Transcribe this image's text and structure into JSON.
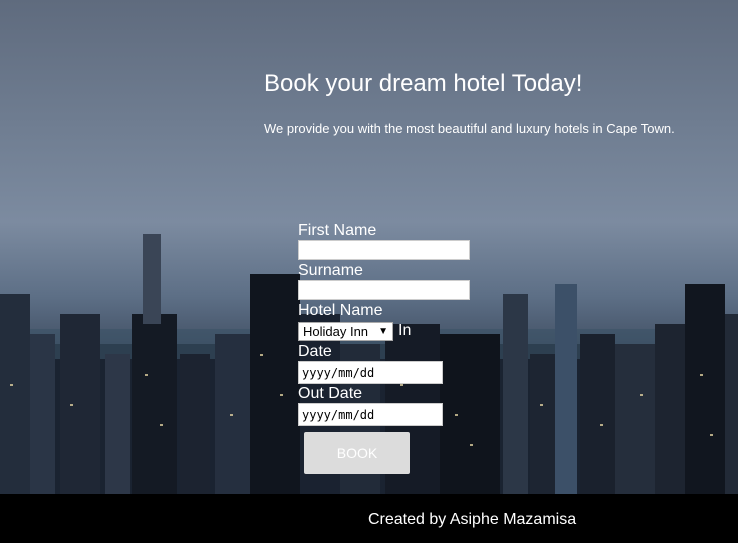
{
  "hero": {
    "title": "Book your dream hotel Today!",
    "subtitle": "We provide you with the most beautiful and luxury hotels in Cape Town."
  },
  "form": {
    "first_name_label": "First Name",
    "first_name_value": "",
    "surname_label": "Surname",
    "surname_value": "",
    "hotel_label": "Hotel Name",
    "hotel_selected": "Holiday Inn",
    "in_date_label_part1": "In",
    "in_date_label_part2": "Date",
    "in_date_placeholder": "yyyy/mm/dd",
    "out_date_label": "Out Date",
    "out_date_placeholder": "yyyy/mm/dd",
    "book_label": "BOOK"
  },
  "footer": {
    "text": "Created by Asiphe Mazamisa"
  },
  "colors": {
    "footer_bg": "#000000",
    "button_bg": "#dcdcdc",
    "text": "#ffffff"
  },
  "icons": {
    "dropdown": "chevron-down-icon",
    "background": "city-skyline-image"
  }
}
